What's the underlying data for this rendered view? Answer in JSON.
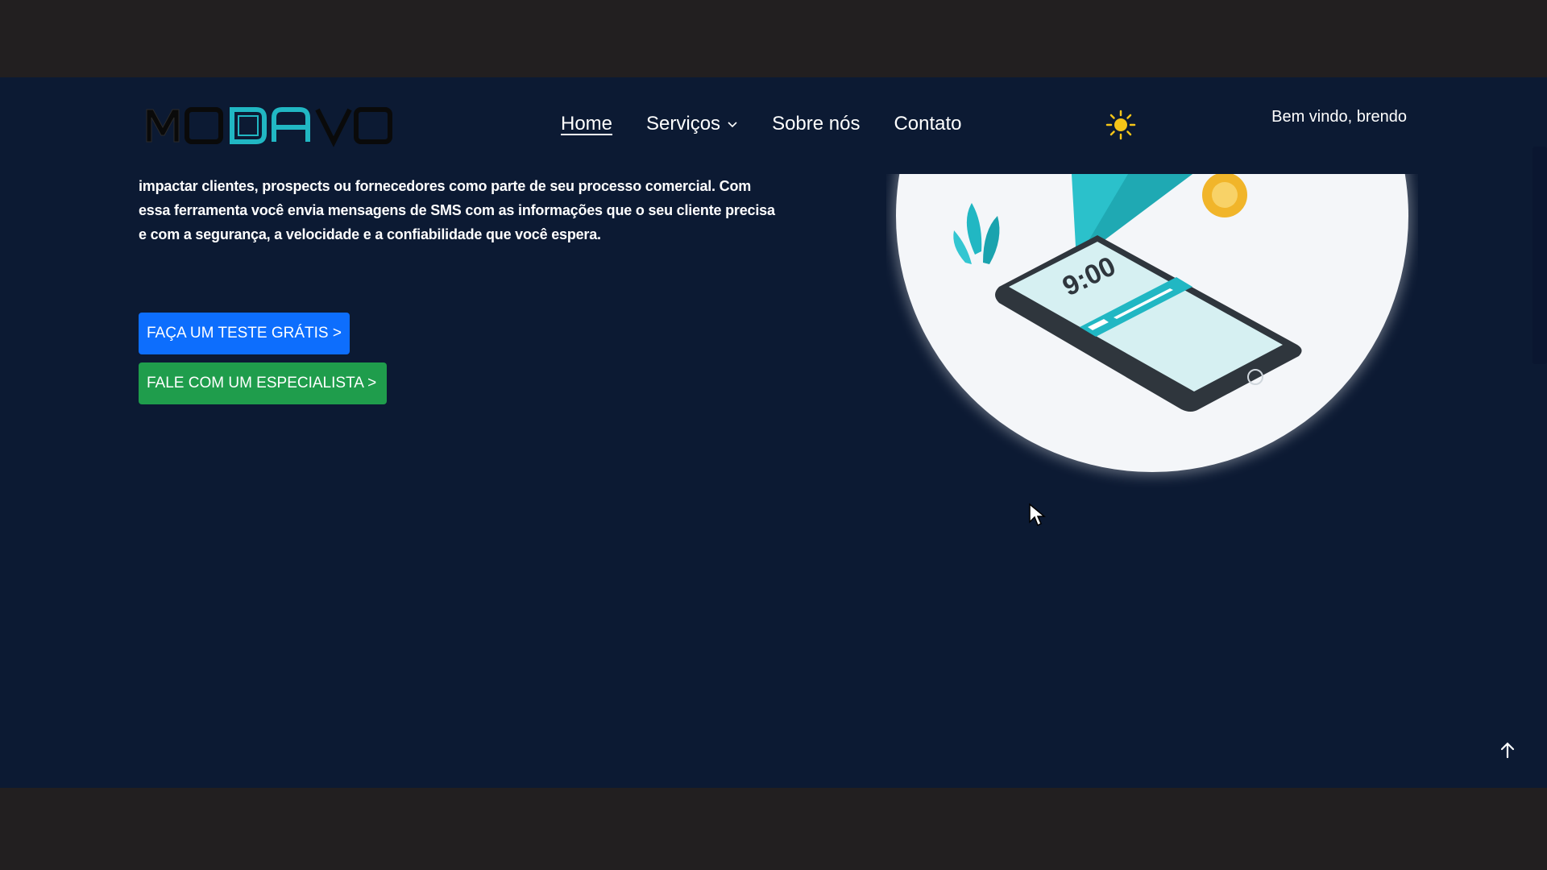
{
  "header": {
    "logo_text": "MODAVO",
    "nav": [
      {
        "label": "Home",
        "active": true
      },
      {
        "label": "Serviços",
        "has_dropdown": true
      },
      {
        "label": "Sobre nós"
      },
      {
        "label": "Contato"
      }
    ],
    "theme_toggle_icon": "sun-icon",
    "welcome": "Bem vindo, brendo"
  },
  "hero": {
    "description": "impactar clientes, prospects ou fornecedores como parte de seu processo comercial. Com essa ferramenta você envia mensagens de SMS com as informações que o seu cliente precisa e com a segurança, a velocidade e a confiabilidade que você espera.",
    "primary_button": "FAÇA UM TESTE GRÁTIS >",
    "secondary_button": "FALE COM UM ESPECIALISTA >",
    "illustration": {
      "phone_time": "9:00"
    }
  },
  "colors": {
    "page_bg": "#0c1a33",
    "letterbox": "#221f20",
    "primary": "#0d6efd",
    "success": "#1f9d4c",
    "accent_teal": "#21b7c3",
    "sun": "#f5c518"
  },
  "back_to_top_icon": "arrow-up-icon"
}
